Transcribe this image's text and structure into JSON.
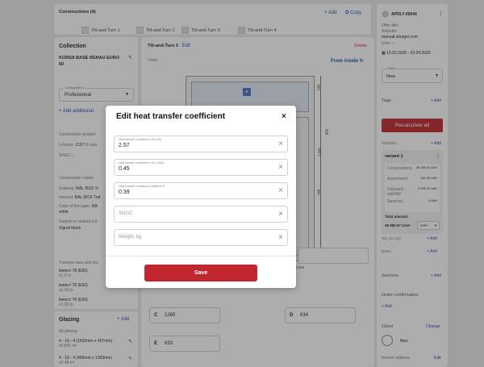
{
  "constructions": {
    "header": "Constructions (4)",
    "add_label": "+ Add",
    "copy_label": "Copy",
    "tabs": [
      "Tilt-and-Turn 1",
      "Tilt-and-Turn 2",
      "Tilt-and-Turn 3",
      "Tilt-and-Turn 4"
    ],
    "active_tab_index": 1
  },
  "collection": {
    "title": "Collection",
    "name": "KORSA BASE REHAU EURO 60",
    "configuration_label": "Configuration",
    "configuration_value": "Professional",
    "add_additional": "+ Add additional",
    "construction_properties": "Construction propert",
    "ufactor_label": "U-factor:",
    "ufactor_value": "2.57",
    "ufactor_tail": "R-valu",
    "shgc_label": "SHGC: –",
    "construction_colors": "Construction colors",
    "external_label": "External:",
    "external_value": "RAL 9016 Tr",
    "internal_label": "Internal:",
    "internal_value": "RAL 9016 Traf",
    "base_color_label": "Color of the base:",
    "base_color_value": "RA",
    "base_color_value2": "white",
    "gasket_label": "Gasket or sealant col",
    "gasket_value": "Signal black",
    "transom_label": "Transom bars and mu",
    "transom_items": [
      {
        "name": "Імпост 78 (E50)",
        "size": "х1.9 m"
      },
      {
        "name": "Імпост 78 (E50)",
        "size": "х1.26 m"
      },
      {
        "name": "Імпост 78 (E50)",
        "size": "х1.26 m"
      }
    ]
  },
  "glazing": {
    "title": "Glazing",
    "add_label": "+ Add",
    "all_glazing": "All glazing",
    "items": [
      {
        "spec": "4 - 16 - 4 (1602mm x 457mm)",
        "area": "х0.842 m²"
      },
      {
        "spec": "4 - 16 - 4 (456mm x 1283mm)",
        "area": "х0.48 m²"
      }
    ]
  },
  "construction_view": {
    "title": "Tilt-and-Turn 3",
    "edit": "Edit",
    "delete": "Delete",
    "view_label": "View:",
    "from_inside": "From inside",
    "dims": [
      "140",
      "965",
      "1260",
      "140"
    ],
    "dim_unit_label": "300 mm",
    "dim_inputs": [
      {
        "letter": "C",
        "value": "1260"
      },
      {
        "letter": "D",
        "value": "634"
      },
      {
        "letter": "E",
        "value": "633"
      }
    ]
  },
  "offer": {
    "id": "APDLY-00044",
    "offer_title_label": "Offer title:",
    "website_label": "Website:",
    "website_value": "manual.vitrager.com",
    "user_label": "User: –",
    "dates": "19.03.2026 - 02.04.2026",
    "status_label": "Status",
    "status_value": "New",
    "tags_label": "Tags",
    "tags_add": "+ Add",
    "recalculate": "Recalculate all",
    "variants_label": "Variants",
    "variants_add": "+ Add",
    "variant_name": "variant 1",
    "variant_rows": [
      {
        "label": "Constructions",
        "value": "35 136.54 UAH"
      },
      {
        "label": "Assortment",
        "value": "164.33 UAH"
      },
      {
        "label": "Discount, add'ItW",
        "value": "2 496.32 UAH"
      },
      {
        "label": "Services",
        "value": "0 UAH"
      }
    ],
    "total_label": "Total amount:",
    "total_value": "35 865 87 UAH",
    "currency": "UAH",
    "tax_label": "Tax (on top)",
    "tax_add": "+ Add",
    "notes_label": "Notes",
    "notes_add": "+ Add",
    "services_label": "Services",
    "services_add": "+ Add",
    "order_conf_label": "Order confirmation",
    "order_conf_add": "+ Add",
    "client_label": "Client",
    "client_change": "Change",
    "client_name": "Max",
    "invoice_label": "Invoice address",
    "invoice_edit": "Edit"
  },
  "modal": {
    "title": "Edit heat transfer coefficient",
    "fields": [
      {
        "label": "Heat transfer coefficient U (by EN)",
        "value": "2.57",
        "placeholder": ""
      },
      {
        "label": "Heat transfer coefficient U (for USA)",
        "value": "0.45",
        "placeholder": ""
      },
      {
        "label": "Heat transfer resistance coefficient R",
        "value": "0.39",
        "placeholder": ""
      },
      {
        "label": "",
        "value": "",
        "placeholder": "SHGC"
      },
      {
        "label": "",
        "value": "",
        "placeholder": "Weight, kg"
      }
    ],
    "save": "Save"
  },
  "colors": {
    "accent": "#c0262d",
    "link": "#1f4fb5"
  }
}
